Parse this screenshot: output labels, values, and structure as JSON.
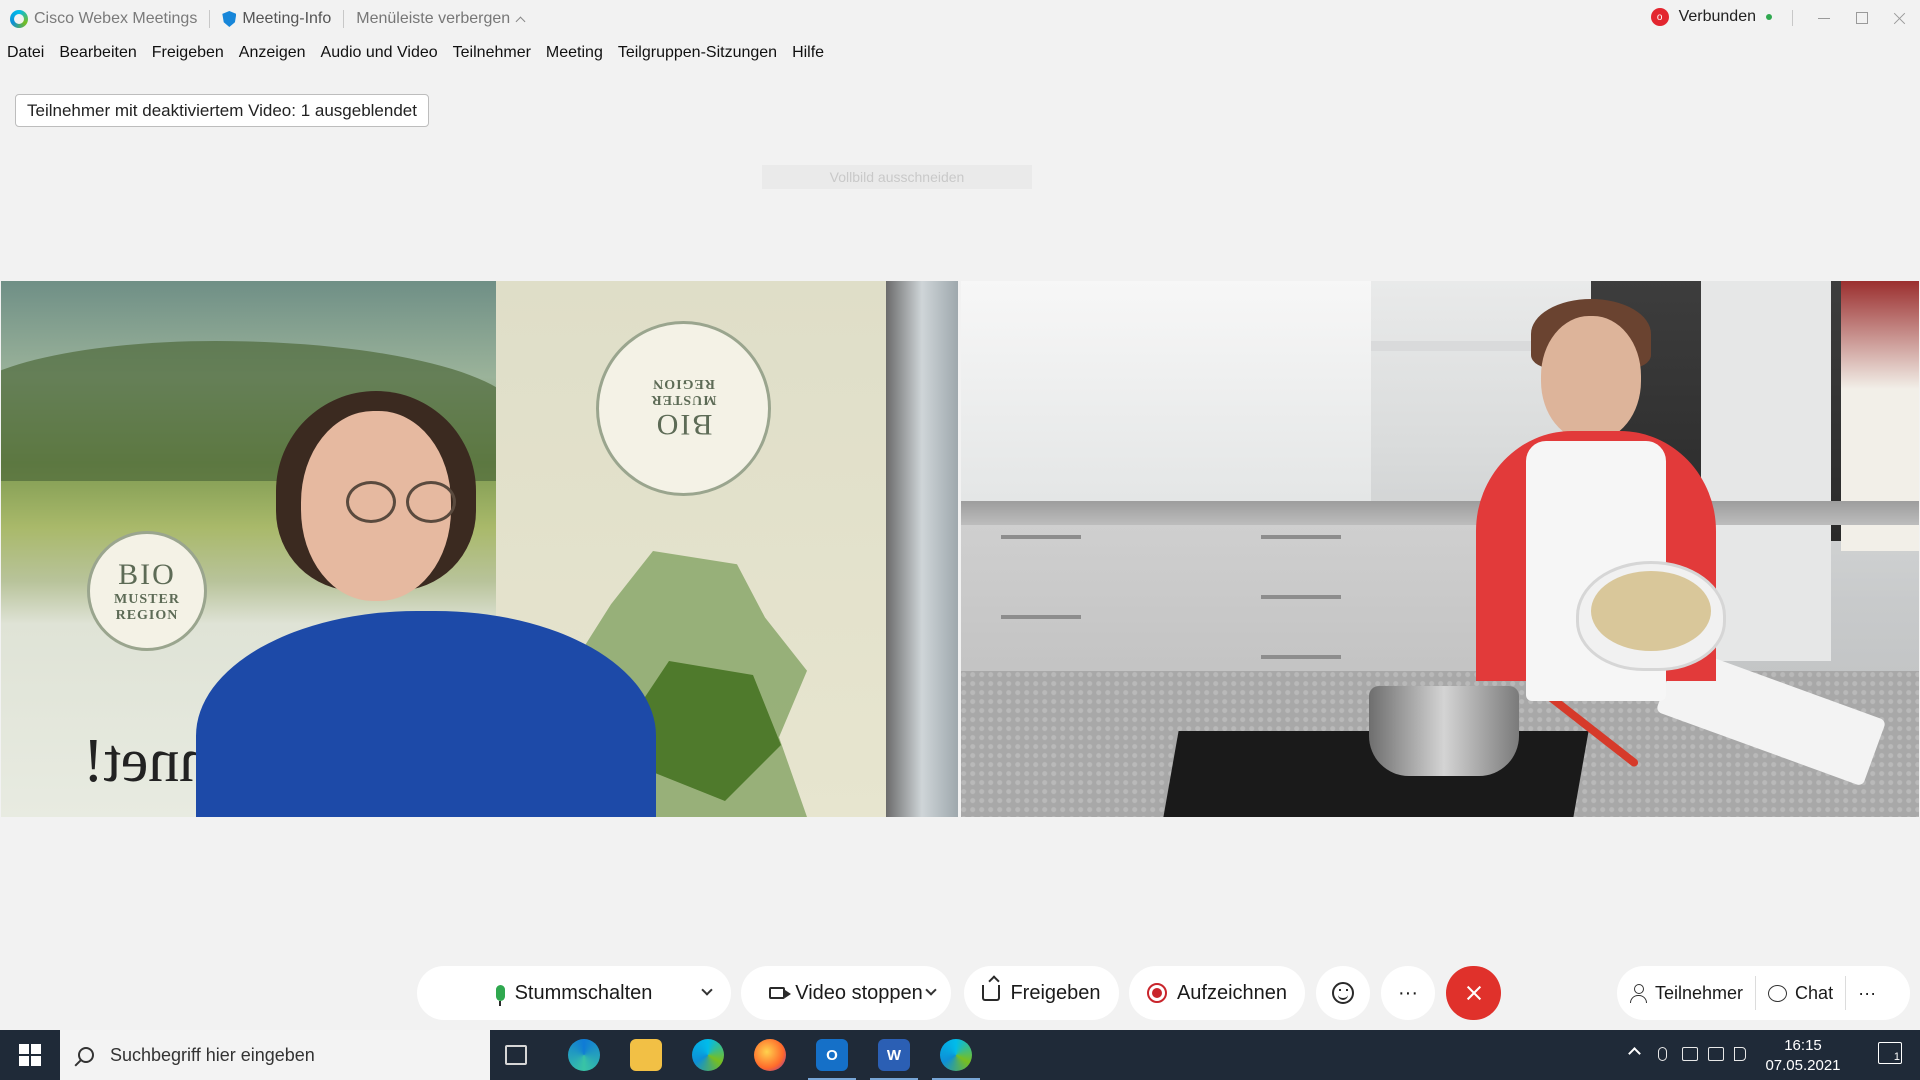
{
  "titlebar": {
    "app_name": "Cisco Webex Meetings",
    "meeting_info": "Meeting-Info",
    "hide_menu": "Menüleiste verbergen",
    "status": "Verbunden",
    "status_color": "#2fa84f",
    "recording_indicator": "o"
  },
  "menu": {
    "items": [
      "Datei",
      "Bearbeiten",
      "Freigeben",
      "Anzeigen",
      "Audio und Video",
      "Teilnehmer",
      "Meeting",
      "Teilgruppen-Sitzungen",
      "Hilfe"
    ]
  },
  "notice": {
    "hidden_participants": "Teilnehmer mit deaktiviertem Video: 1 ausgeblendet",
    "fullscreen_hint": "Vollbild ausschneiden"
  },
  "video_left": {
    "badge_line1": "BIO",
    "badge_line2": "MUSTER",
    "badge_line3": "REGION",
    "backdrop_text": "hnet!"
  },
  "controls": {
    "mute": "Stummschalten",
    "video": "Video stoppen",
    "share": "Freigeben",
    "record": "Aufzeichnen",
    "more": "···",
    "participants": "Teilnehmer",
    "chat": "Chat",
    "end_color": "#e0312b"
  },
  "taskbar": {
    "search_placeholder": "Suchbegriff hier eingeben",
    "time": "16:15",
    "date": "07.05.2021",
    "notifications": "1",
    "apps": [
      "task-view",
      "edge",
      "file-explorer",
      "webex",
      "firefox",
      "outlook",
      "word",
      "webex-meetings"
    ]
  }
}
